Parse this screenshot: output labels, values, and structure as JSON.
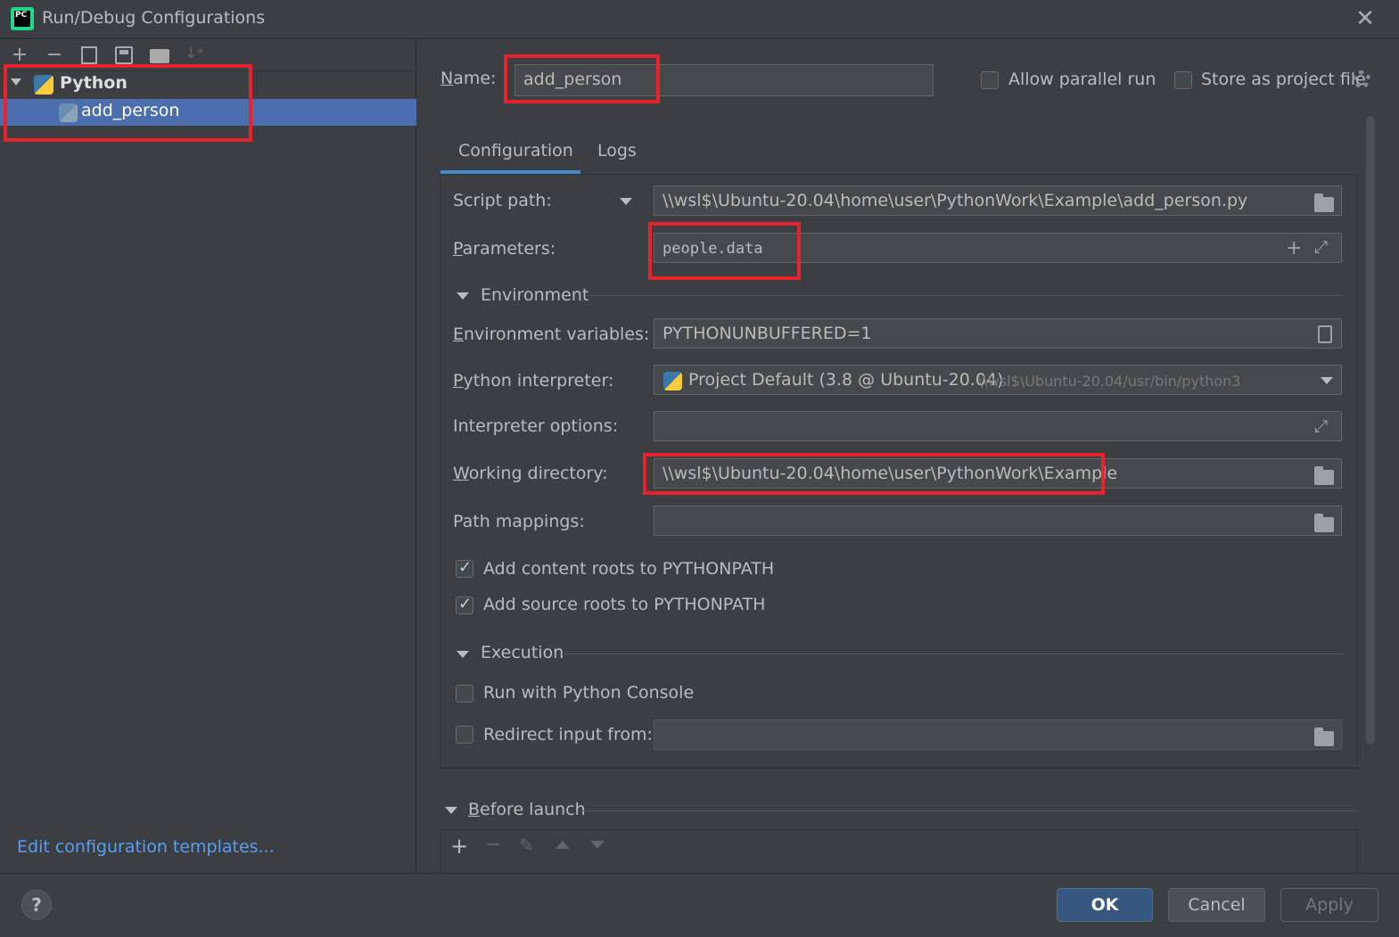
{
  "window": {
    "title": "Run/Debug Configurations",
    "app_icon_text": "PC"
  },
  "toolbar": {
    "add": "+",
    "remove": "−",
    "copy": "⧉",
    "save": "▤",
    "folder": "▸",
    "sort": "↓ᵃ"
  },
  "tree": {
    "group_label": "Python",
    "child_label": "add_person"
  },
  "left_footer": {
    "edit_templates": "Edit configuration templates..."
  },
  "header": {
    "name_label": "Name:",
    "name_value": "add_person",
    "allow_parallel_label": "Allow parallel run",
    "allow_parallel_checked": false,
    "store_label": "Store as project file",
    "store_checked": false
  },
  "tabs": {
    "configuration": "Configuration",
    "logs": "Logs"
  },
  "config": {
    "script_path_label": "Script path:",
    "script_path_value": "\\\\wsl$\\Ubuntu-20.04\\home\\user\\PythonWork\\Example\\add_person.py",
    "parameters_label": "Parameters:",
    "parameters_value": "people.data",
    "environment_section": "Environment",
    "env_vars_label": "Environment variables:",
    "env_vars_value": "PYTHONUNBUFFERED=1",
    "interpreter_label": "Python interpreter:",
    "interpreter_value": "Project Default (3.8 @ Ubuntu-20.04)",
    "interpreter_path": "\\\\wsl$\\Ubuntu-20.04/usr/bin/python3",
    "interp_options_label": "Interpreter options:",
    "interp_options_value": "",
    "working_dir_label": "Working directory:",
    "working_dir_value": "\\\\wsl$\\Ubuntu-20.04\\home\\user\\PythonWork\\Example",
    "path_mappings_label": "Path mappings:",
    "path_mappings_value": "",
    "content_roots_label": "Add content roots to PYTHONPATH",
    "content_roots_checked": true,
    "source_roots_label": "Add source roots to PYTHONPATH",
    "source_roots_checked": true,
    "execution_section": "Execution",
    "python_console_label": "Run with Python Console",
    "python_console_checked": false,
    "redirect_label": "Redirect input from:",
    "redirect_checked": false,
    "redirect_value": ""
  },
  "before_launch": {
    "label": "Before launch"
  },
  "buttons": {
    "help": "?",
    "ok": "OK",
    "cancel": "Cancel",
    "apply": "Apply"
  },
  "colors": {
    "background": "#3c3f41",
    "selection": "#4b6eaf",
    "link": "#589df6",
    "highlight_box": "#e8232f",
    "ok_button": "#365880"
  }
}
